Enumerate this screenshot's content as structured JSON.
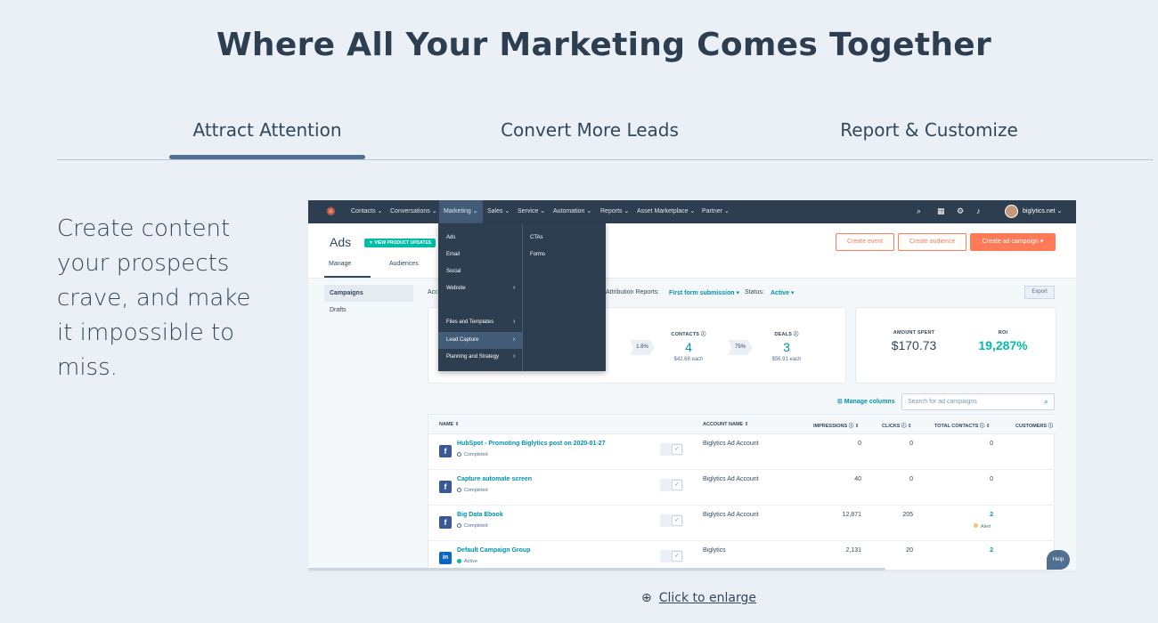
{
  "headline": "Where All Your Marketing Comes Together",
  "tabs": [
    "Attract Attention",
    "Convert More Leads",
    "Report & Customize"
  ],
  "left_copy": "Create content your prospects crave, and make it impossible to miss.",
  "enlarge_label": "Click to enlarge",
  "colors": {
    "background": "#eaf0f6",
    "accent_orange": "#ff7a59",
    "nav_dark": "#2d3e50",
    "link_teal": "#0091ae",
    "tab_underline": "#516f90"
  },
  "app": {
    "nav": {
      "items": [
        "Contacts ⌄",
        "Conversations ⌄",
        "Marketing ⌄",
        "Sales ⌄",
        "Service ⌄",
        "Automation ⌄",
        "Reports ⌄",
        "Asset Marketplace ⌄",
        "Partner ⌄"
      ],
      "account": "biglytics.net ⌄"
    },
    "page_title": "Ads",
    "badge": "▼ VIEW PRODUCT UPDATES",
    "subtabs": [
      "Manage",
      "Audiences"
    ],
    "buttons": {
      "create_event": "Create event",
      "create_audience": "Create audience",
      "create_campaign": "Create ad campaign ▾"
    },
    "sidebar": [
      "Campaigns",
      "Drafts"
    ],
    "filters": {
      "prefix": "Acc",
      "attribution_label": "Attribution Reports:",
      "attribution_value": "First form submission ▾",
      "status_label": "Status:",
      "status_value": "Active ▾"
    },
    "export": "Export",
    "marketing_menu": {
      "left": [
        "Ads",
        "Email",
        "Social",
        "Website",
        "Files and Templates",
        "Lead Capture",
        "Planning and Strategy"
      ],
      "right": [
        "CTAs",
        "Forms"
      ]
    },
    "stats": {
      "chev1": "1.8%",
      "chev2": "75%",
      "contacts": {
        "label": "CONTACTS ⓘ",
        "value": "4",
        "sub": "$42.68 each"
      },
      "deals": {
        "label": "DEALS ⓘ",
        "value": "3",
        "sub": "$56.91 each"
      },
      "amount_spent": {
        "label": "AMOUNT SPENT",
        "value": "$170.73"
      },
      "roi": {
        "label": "ROI",
        "value": "19,287%"
      }
    },
    "manage_columns": "⊞ Manage columns",
    "search_placeholder": "Search for ad campaigns",
    "table": {
      "headers": [
        "NAME ⇕",
        "ACCOUNT NAME ⇕",
        "IMPRESSIONS ⓘ ⇕",
        "CLICKS ⓘ ⇕",
        "TOTAL CONTACTS ⓘ ⇕",
        "CUSTOMERS ⓘ"
      ],
      "rows": [
        {
          "network": "f",
          "name": "HubSpot - Promoting Biglytics post on 2020-01-27",
          "status": "Completed",
          "account": "Biglytics Ad Account",
          "impressions": "0",
          "clicks": "0",
          "contacts": "0"
        },
        {
          "network": "f",
          "name": "Capture automate screen",
          "status": "Completed",
          "account": "Biglytics Ad Account",
          "impressions": "40",
          "clicks": "0",
          "contacts": "0"
        },
        {
          "network": "f",
          "name": "Big Data Ebook",
          "status": "Completed",
          "account": "Biglytics Ad Account",
          "impressions": "12,871",
          "clicks": "205",
          "contacts": "2",
          "alert": "Alert"
        },
        {
          "network": "in",
          "name": "Default Campaign Group",
          "status": "Active",
          "account": "Biglytics",
          "impressions": "2,131",
          "clicks": "20",
          "contacts": "2"
        }
      ]
    },
    "help": "Help"
  }
}
